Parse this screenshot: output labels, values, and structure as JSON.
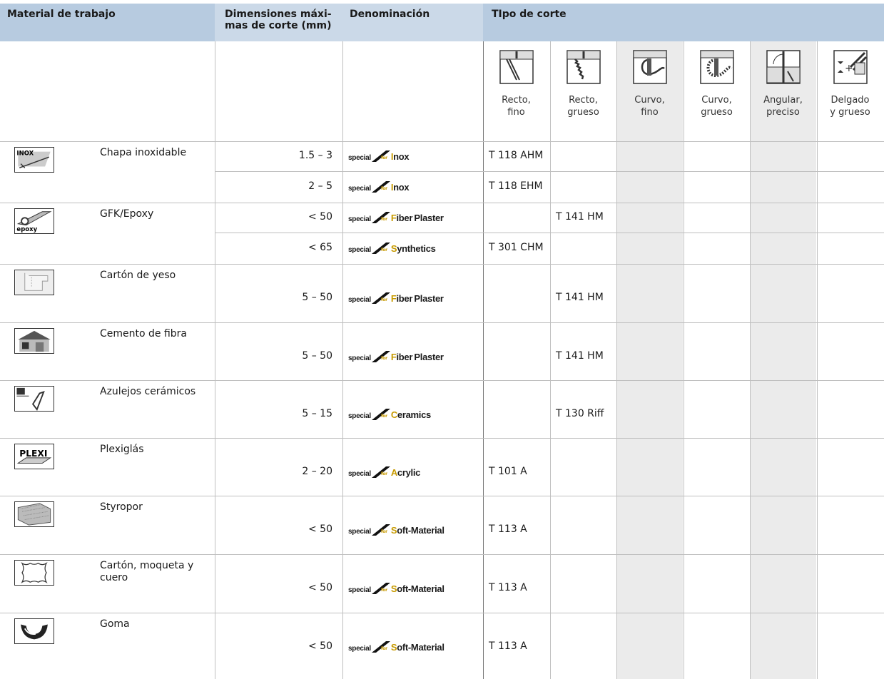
{
  "headers": {
    "material": "Material de trabajo",
    "dimensions": "Dimensiones máxi-\nmas de corte (mm)",
    "designation": "Denominación",
    "cut_type": "TIpo de corte"
  },
  "cut_types": [
    {
      "label": "Recto,\nfino",
      "icon": "straight-fine-cut-icon"
    },
    {
      "label": "Recto,\ngrueso",
      "icon": "straight-coarse-cut-icon"
    },
    {
      "label": "Curvo,\nfino",
      "icon": "curved-fine-cut-icon"
    },
    {
      "label": "Curvo,\ngrueso",
      "icon": "curved-coarse-cut-icon"
    },
    {
      "label": "Angular,\npreciso",
      "icon": "angular-precise-cut-icon"
    },
    {
      "label": "Delgado\ny grueso",
      "icon": "thin-thick-cut-icon"
    }
  ],
  "rows": [
    {
      "material": "Chapa inoxidable",
      "icon": "inox-sheet-icon",
      "icon_text": "INOX",
      "entries": [
        {
          "dim": "1.5 – 3",
          "brand_word": "Inox",
          "code": "T 118 AHM",
          "col": 0
        },
        {
          "dim": "2 – 5",
          "brand_word": "Inox",
          "code": "T 118 EHM",
          "col": 0
        }
      ]
    },
    {
      "material": "GFK/Epoxy",
      "icon": "epoxy-icon",
      "icon_text": "epoxy",
      "entries": [
        {
          "dim": "< 50",
          "brand_word": "Fiber Plaster",
          "code": "T 141 HM",
          "col": 1
        },
        {
          "dim": "< 65",
          "brand_word": "Synthetics",
          "code": "T 301 CHM",
          "col": 0
        }
      ]
    },
    {
      "material": "Cartón de yeso",
      "icon": "plasterboard-icon",
      "entries": [
        {
          "dim": "5 – 50",
          "brand_word": "Fiber Plaster",
          "code": "T 141 HM",
          "col": 1
        }
      ]
    },
    {
      "material": "Cemento de fibra",
      "icon": "fiber-cement-house-icon",
      "entries": [
        {
          "dim": "5 – 50",
          "brand_word": "Fiber Plaster",
          "code": "T 141 HM",
          "col": 1
        }
      ]
    },
    {
      "material": "Azulejos cerámicos",
      "icon": "ceramic-tile-icon",
      "entries": [
        {
          "dim": "5 – 15",
          "brand_word": "Ceramics",
          "code": "T 130 Riff",
          "col": 1
        }
      ]
    },
    {
      "material": "Plexiglás",
      "icon": "plexi-icon",
      "icon_text": "PLEXI",
      "entries": [
        {
          "dim": "2 – 20",
          "brand_word": "Acrylic",
          "code": "T 101 A",
          "col": 0
        }
      ]
    },
    {
      "material": "Styropor",
      "icon": "styrofoam-icon",
      "entries": [
        {
          "dim": "< 50",
          "brand_word": "Soft-Material",
          "code": "T 113 A",
          "col": 0
        }
      ]
    },
    {
      "material": "Cartón, moqueta y\ncuero",
      "icon": "leather-hide-icon",
      "entries": [
        {
          "dim": "< 50",
          "brand_word": "Soft-Material",
          "code": "T 113 A",
          "col": 0
        }
      ]
    },
    {
      "material": "Goma",
      "icon": "rubber-profile-icon",
      "entries": [
        {
          "dim": "< 50",
          "brand_word": "Soft-Material",
          "code": "T 113 A",
          "col": 0
        }
      ]
    }
  ],
  "brand_prefix": "special",
  "brand_for": "for",
  "colors": {
    "header_blue": "#b7cbe0",
    "header_light": "#cbd9e8",
    "shade": "#ebebeb",
    "brand_gold": "#c79a00"
  }
}
